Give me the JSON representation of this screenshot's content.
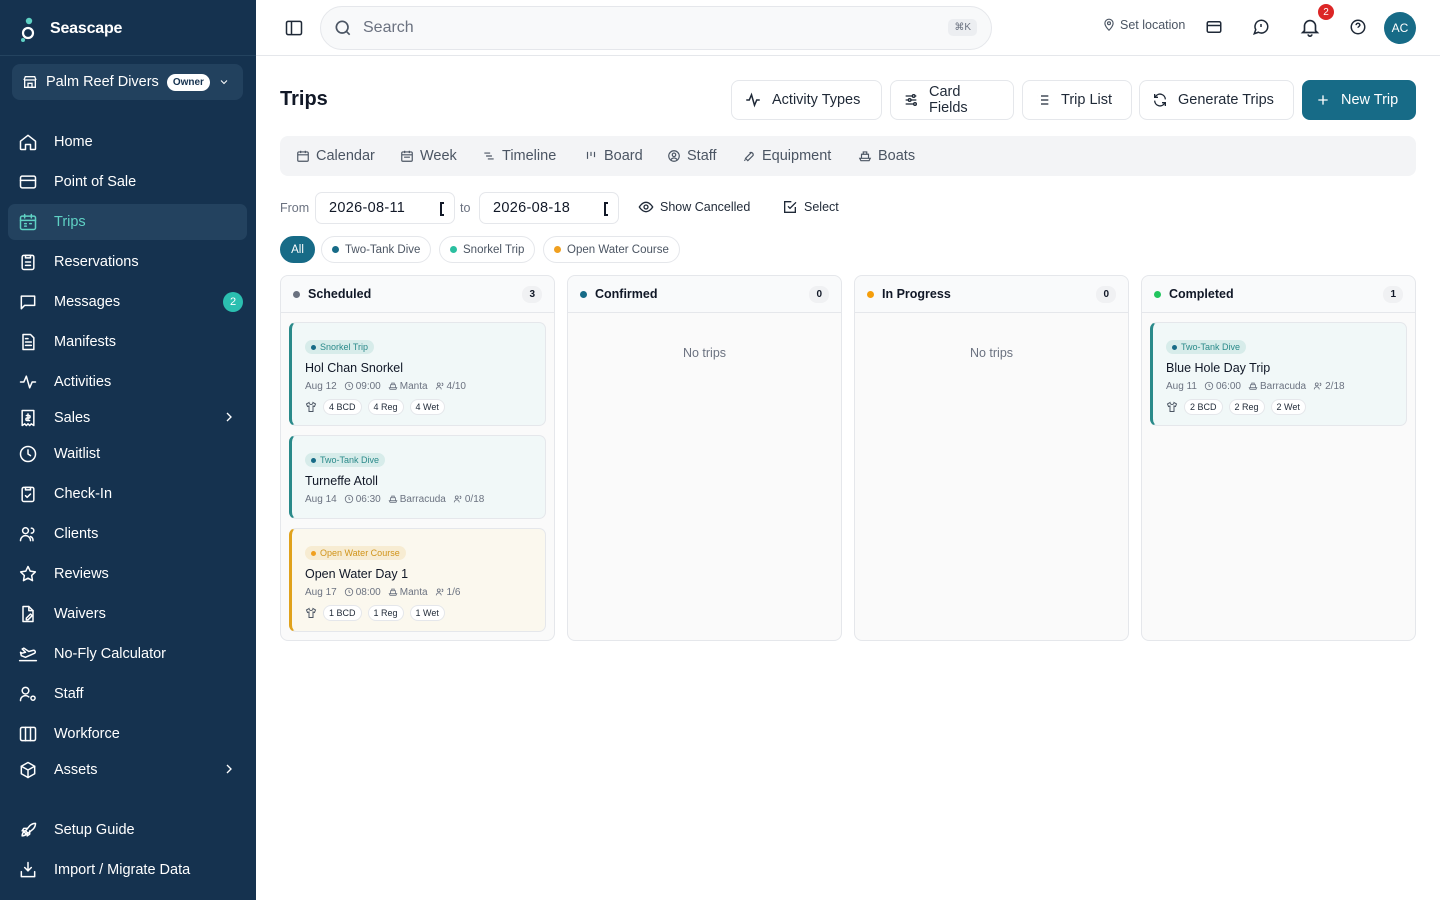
{
  "brand": {
    "name": "Seascape",
    "accent": "#176b87",
    "sidebar_bg": "#15324f"
  },
  "org": {
    "name": "Palm Reef Divers",
    "role": "Owner"
  },
  "sidebar": {
    "items": [
      {
        "label": "Home",
        "icon": "home-icon"
      },
      {
        "label": "Point of Sale",
        "icon": "credit-card-icon"
      },
      {
        "label": "Trips",
        "icon": "calendar-icon",
        "active": true
      },
      {
        "label": "Reservations",
        "icon": "clipboard-icon"
      },
      {
        "label": "Messages",
        "icon": "message-icon",
        "badge": "2"
      },
      {
        "label": "Manifests",
        "icon": "file-icon"
      },
      {
        "label": "Activities",
        "icon": "activity-icon"
      },
      {
        "label": "Sales",
        "icon": "receipt-icon",
        "expandable": true
      },
      {
        "label": "Waitlist",
        "icon": "clock-icon"
      },
      {
        "label": "Check-In",
        "icon": "clipboard-check-icon"
      },
      {
        "label": "Clients",
        "icon": "users-icon"
      },
      {
        "label": "Reviews",
        "icon": "star-icon"
      },
      {
        "label": "Waivers",
        "icon": "file-edit-icon"
      },
      {
        "label": "No-Fly Calculator",
        "icon": "plane-icon"
      },
      {
        "label": "Staff",
        "icon": "user-cog-icon"
      },
      {
        "label": "Workforce",
        "icon": "columns-icon"
      },
      {
        "label": "Assets",
        "icon": "box-icon",
        "expandable": true
      },
      {
        "label": "Setup Guide",
        "icon": "rocket-icon"
      },
      {
        "label": "Import / Migrate Data",
        "icon": "import-icon"
      }
    ]
  },
  "topbar": {
    "search_placeholder": "Search",
    "shortcut": "⌘K",
    "location": "Set location",
    "notifications": "2",
    "avatar": "AC"
  },
  "page": {
    "title": "Trips",
    "actions": [
      {
        "label": "Activity Types",
        "icon": "activity-icon"
      },
      {
        "label": "Card Fields",
        "icon": "sliders-icon"
      },
      {
        "label": "Trip List",
        "icon": "list-icon"
      },
      {
        "label": "Generate Trips",
        "icon": "refresh-icon"
      },
      {
        "label": "New Trip",
        "icon": "plus-icon",
        "primary": true
      }
    ]
  },
  "views": [
    {
      "label": "Calendar",
      "icon": "calendar-icon"
    },
    {
      "label": "Week",
      "icon": "calendar-week-icon"
    },
    {
      "label": "Timeline",
      "icon": "timeline-icon"
    },
    {
      "label": "Board",
      "icon": "board-icon",
      "active": true
    },
    {
      "label": "Staff",
      "icon": "user-circle-icon"
    },
    {
      "label": "Equipment",
      "icon": "wrench-icon"
    },
    {
      "label": "Boats",
      "icon": "ship-icon"
    }
  ],
  "filters": {
    "from_label": "From",
    "to_label": "to",
    "from_date": "2026-08-11",
    "to_date": "2026-08-18",
    "show_cancelled": "Show Cancelled",
    "select": "Select",
    "chips": [
      {
        "label": "All",
        "active": true
      },
      {
        "label": "Two-Tank Dive",
        "color": "#176b87"
      },
      {
        "label": "Snorkel Trip",
        "color": "#2bbfa0"
      },
      {
        "label": "Open Water Course",
        "color": "#f0a020"
      }
    ]
  },
  "board": {
    "empty_text": "No trips",
    "columns": [
      {
        "title": "Scheduled",
        "count": "3",
        "color": "#6b7280",
        "cards": [
          {
            "tag": "Snorkel Trip",
            "variant": "teal",
            "title": "Hol Chan Snorkel",
            "date": "Aug 12",
            "time": "09:00",
            "boat": "Manta",
            "capacity": "4/10",
            "gear": [
              "4 BCD",
              "4 Reg",
              "4 Wet"
            ]
          },
          {
            "tag": "Two-Tank Dive",
            "variant": "teal",
            "title": "Turneffe Atoll",
            "date": "Aug 14",
            "time": "06:30",
            "boat": "Barracuda",
            "capacity": "0/18",
            "gear": []
          },
          {
            "tag": "Open Water Course",
            "variant": "amber",
            "title": "Open Water Day 1",
            "date": "Aug 17",
            "time": "08:00",
            "boat": "Manta",
            "capacity": "1/6",
            "gear": [
              "1 BCD",
              "1 Reg",
              "1 Wet"
            ]
          }
        ]
      },
      {
        "title": "Confirmed",
        "count": "0",
        "color": "#176b87",
        "cards": []
      },
      {
        "title": "In Progress",
        "count": "0",
        "color": "#f59e0b",
        "cards": []
      },
      {
        "title": "Completed",
        "count": "1",
        "color": "#22c55e",
        "cards": [
          {
            "tag": "Two-Tank Dive",
            "variant": "teal",
            "title": "Blue Hole Day Trip",
            "date": "Aug 11",
            "time": "06:00",
            "boat": "Barracuda",
            "capacity": "2/18",
            "gear": [
              "2 BCD",
              "2 Reg",
              "2 Wet"
            ]
          }
        ]
      }
    ]
  }
}
